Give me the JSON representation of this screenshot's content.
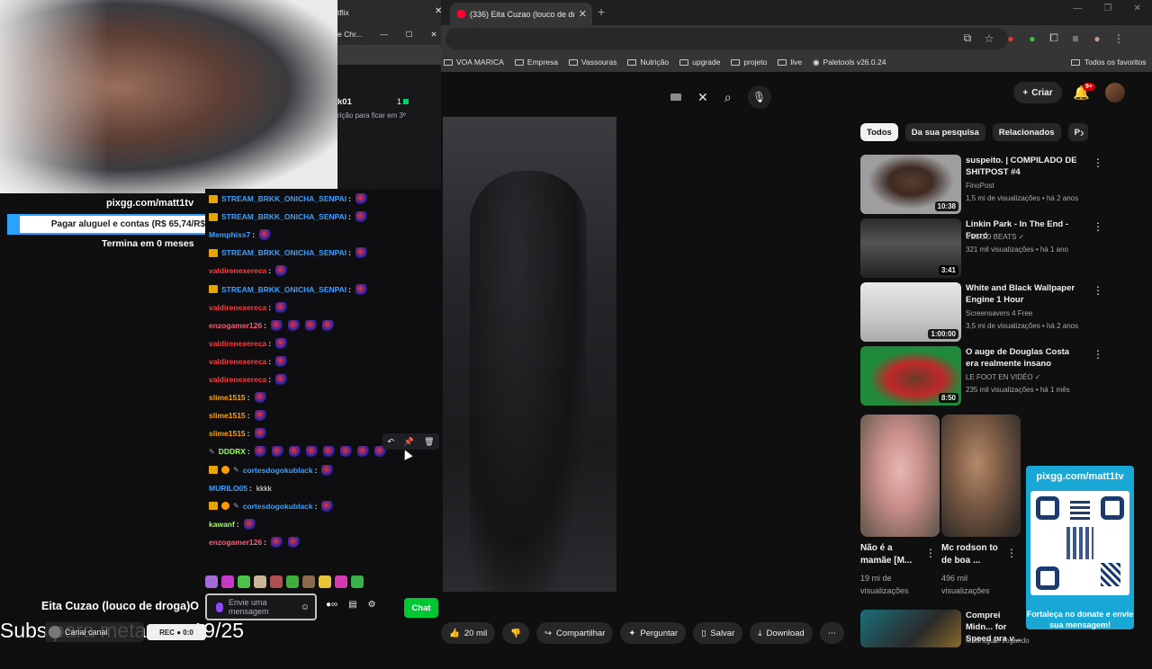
{
  "chrome": {
    "tab_title": "(336) Eita Cuzao (louco de drog",
    "bookmarks": [
      "VOA MARICA",
      "Empresa",
      "Vassouras",
      "Nutrição",
      "upgrade",
      "projeto",
      "live",
      "Paletools v26.0.24"
    ],
    "bookmarks_all": "Todos os favoritos"
  },
  "chat_window": {
    "title_fragment": "tflix",
    "bar_fragment": "e Chr...",
    "user_fragment": "k01",
    "user_count": "1",
    "sub_fragment": "rição para ficar em 3º"
  },
  "overlay": {
    "pixgg_url": "pixgg.com/matt1tv",
    "goal_text": "Pagar aluguel e contas (R$ 65,74/R$ 1.500,00)",
    "goal_fraction": 0.044,
    "goal_end": "Termina em 0 meses",
    "stream_title": "Eita Cuzao (louco de droga)O",
    "subgoal": "Subs para meta:      car 19/25",
    "canal_label": "Canal canal",
    "rec_label": "REC ● 0:0",
    "qr_url": "pixgg.com/matt1tv",
    "qr_message": "Fortaleça no donate e envie sua mensagem!"
  },
  "chat": {
    "messages": [
      {
        "user": "STREAM_BRKK_ONICHA_SENPAI",
        "color": "#3aa0ff",
        "crown": true,
        "emotes": 1,
        "text": ""
      },
      {
        "user": "STREAM_BRKK_ONICHA_SENPAI",
        "color": "#3aa0ff",
        "crown": true,
        "emotes": 1,
        "text": ""
      },
      {
        "user": "Memphiss7",
        "color": "#3aa0ff",
        "crown": false,
        "emotes": 1,
        "text": ""
      },
      {
        "user": "STREAM_BRKK_ONICHA_SENPAI",
        "color": "#3aa0ff",
        "crown": true,
        "emotes": 1,
        "text": ""
      },
      {
        "user": "valdirenexereca",
        "color": "#ff3b3b",
        "crown": false,
        "emotes": 1,
        "text": ""
      },
      {
        "user": "STREAM_BRKK_ONICHA_SENPAI",
        "color": "#3aa0ff",
        "crown": true,
        "emotes": 1,
        "text": ""
      },
      {
        "user": "valdirenexereca",
        "color": "#ff3b3b",
        "crown": false,
        "emotes": 1,
        "text": ""
      },
      {
        "user": "enzogamer126",
        "color": "#ff5a7a",
        "crown": false,
        "emotes": 4,
        "text": ""
      },
      {
        "user": "valdirenexereca",
        "color": "#ff3b3b",
        "crown": false,
        "emotes": 1,
        "text": ""
      },
      {
        "user": "valdirenexereca",
        "color": "#ff3b3b",
        "crown": false,
        "emotes": 1,
        "text": ""
      },
      {
        "user": "valdirenexereca",
        "color": "#ff3b3b",
        "crown": false,
        "emotes": 1,
        "text": ""
      },
      {
        "user": "slime1515",
        "color": "#ffa500",
        "crown": false,
        "emotes": 1,
        "text": ""
      },
      {
        "user": "slime1515",
        "color": "#ffa500",
        "crown": false,
        "emotes": 1,
        "text": ""
      },
      {
        "user": "slime1515",
        "color": "#ffa500",
        "crown": false,
        "emotes": 1,
        "text": ""
      },
      {
        "user": "DDDRX",
        "color": "#9aff5a",
        "crown": false,
        "pencil": true,
        "emotes": 8,
        "text": ""
      },
      {
        "user": "cortesdogokublack",
        "color": "#3aa0ff",
        "crown": true,
        "warn": true,
        "pencil": true,
        "emotes": 1,
        "text": ""
      },
      {
        "user": "MURILO05",
        "color": "#3aa0ff",
        "crown": false,
        "emotes": 0,
        "text": "kkkk"
      },
      {
        "user": "cortesdogokublack",
        "color": "#3aa0ff",
        "crown": true,
        "warn": true,
        "pencil": true,
        "emotes": 1,
        "text": ""
      },
      {
        "user": "kawanf",
        "color": "#9aff5a",
        "crown": false,
        "emotes": 1,
        "text": ""
      },
      {
        "user": "enzogamer126",
        "color": "#ff5a7a",
        "crown": false,
        "emotes": 2,
        "text": ""
      }
    ],
    "input_placeholder": "Envie uma mensagem",
    "send_label": "Chat"
  },
  "youtube": {
    "create_label": "Criar",
    "notif_count": "9+",
    "chips": [
      "Todos",
      "Da sua pesquisa",
      "Relacionados",
      "P"
    ],
    "recommendations": [
      {
        "title": "suspeito. | COMPILADO DE SHITPOST #4",
        "channel": "FinoPost",
        "verified": false,
        "meta": "1,5 mi de visualizações • há 2 anos",
        "duration": "10:38",
        "thumb": "#6b6b6b"
      },
      {
        "title": "Linkin Park - In The End - Forró",
        "channel": "VESGO BEATS",
        "verified": true,
        "meta": "321 mil visualizações • há 1 ano",
        "duration": "3:41",
        "thumb": "#3a3a3a"
      },
      {
        "title": "White and Black Wallpaper Engine 1 Hour",
        "channel": "Screensavers 4 Free",
        "verified": false,
        "meta": "3,5 mi de visualizações • há 2 anos",
        "duration": "1:00:00",
        "thumb": "#d6d6d6"
      },
      {
        "title": "O auge de Douglas Costa era realmente insano",
        "channel": "LE FOOT EN VIDÉO",
        "verified": true,
        "meta": "235 mil visualizações • há 1 mês",
        "duration": "8:50",
        "thumb": "#1f8a3a"
      }
    ],
    "shorts": [
      {
        "title": "Não é a mamãe [M...",
        "views": "19 mi de visualizações"
      },
      {
        "title": "Mc rodson to de boa ...",
        "views": "496 mil visualizações"
      }
    ],
    "last_rec": {
      "title": "Comprei Midn... for Speed pra v...",
      "channel": "Madruguei Jogando"
    },
    "actions": {
      "likes": "20 mil",
      "share": "Compartilhar",
      "ask": "Perguntar",
      "save": "Salvar",
      "download": "Download"
    }
  }
}
